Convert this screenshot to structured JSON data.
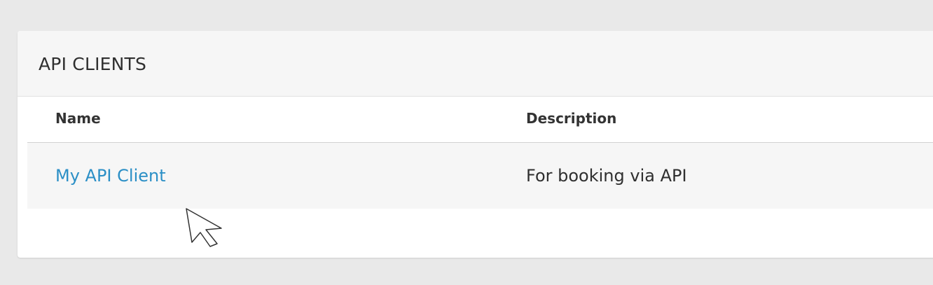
{
  "panel": {
    "title": "API CLIENTS"
  },
  "table": {
    "columns": [
      "Name",
      "Description"
    ],
    "rows": [
      {
        "name": "My API Client",
        "description": "For booking via API"
      }
    ]
  },
  "colors": {
    "link": "#2b8fc6",
    "background": "#e9e9e9",
    "header_bg": "#f6f6f6"
  }
}
